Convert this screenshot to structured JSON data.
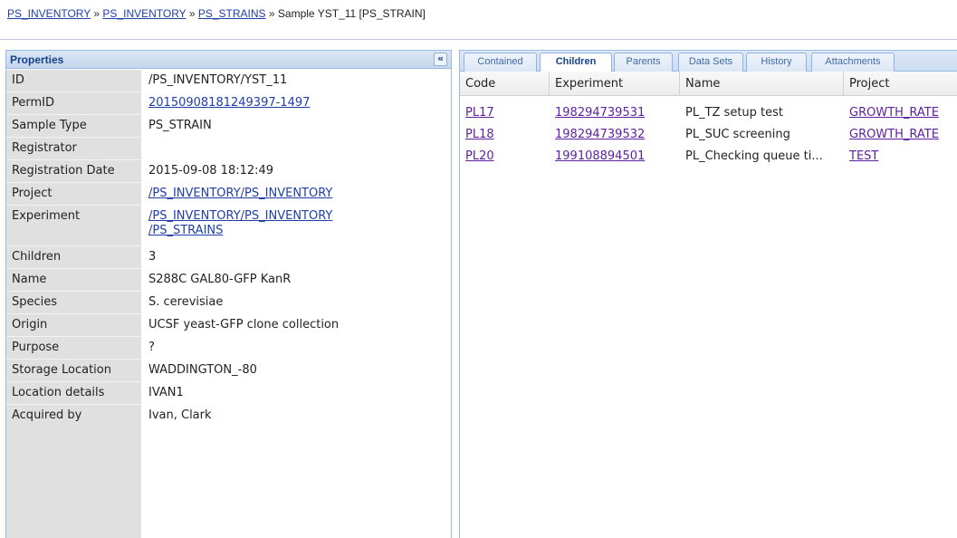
{
  "breadcrumb": {
    "items": [
      "PS_INVENTORY",
      "PS_INVENTORY",
      "PS_STRAINS"
    ],
    "separator": "»",
    "current": "Sample YST_11 [PS_STRAIN]"
  },
  "properties": {
    "title": "Properties",
    "collapse_glyph": "«",
    "rows": [
      {
        "key": "ID",
        "value": "/PS_INVENTORY/YST_11"
      },
      {
        "key": "PermID",
        "value": "20150908181249397-1497"
      },
      {
        "key": "Sample Type",
        "value": "PS_STRAIN"
      },
      {
        "key": "Registrator",
        "value": ""
      },
      {
        "key": "Registration Date",
        "value": "2015-09-08 18:12:49"
      },
      {
        "key": "Project",
        "value": "/PS_INVENTORY/PS_INVENTORY"
      },
      {
        "key": "Experiment",
        "value": "/PS_INVENTORY/PS_INVENTORY",
        "value2": "/PS_STRAINS"
      },
      {
        "key": "Children",
        "value": "3"
      },
      {
        "key": "Name",
        "value": "S288C GAL80-GFP KanR"
      },
      {
        "key": "Species",
        "value": "S. cerevisiae"
      },
      {
        "key": "Origin",
        "value": "UCSF yeast-GFP clone collection"
      },
      {
        "key": "Purpose",
        "value": "?"
      },
      {
        "key": "Storage Location",
        "value": "WADDINGTON_-80"
      },
      {
        "key": "Location details",
        "value": "IVAN1"
      },
      {
        "key": "Acquired by",
        "value": "Ivan, Clark"
      }
    ]
  },
  "tabs": [
    "Contained",
    "Children",
    "Parents",
    "Data Sets",
    "History",
    "Attachments"
  ],
  "grid": {
    "columns": [
      "Code",
      "Experiment",
      "Name",
      "Project"
    ],
    "rows": [
      {
        "code": "PL17",
        "experiment": "198294739531",
        "name": "PL_TZ setup test",
        "project": "GROWTH_RATE"
      },
      {
        "code": "PL18",
        "experiment": "198294739532",
        "name": "PL_SUC screening",
        "project": "GROWTH_RATE"
      },
      {
        "code": "PL20",
        "experiment": "199108894501",
        "name": "PL_Checking queue ti...",
        "project": "TEST"
      }
    ]
  },
  "colors": {
    "link": "#1f3ea8",
    "visited_link": "#5b1fa0",
    "panel_border": "#99bbe8",
    "header_text": "#15428b"
  }
}
